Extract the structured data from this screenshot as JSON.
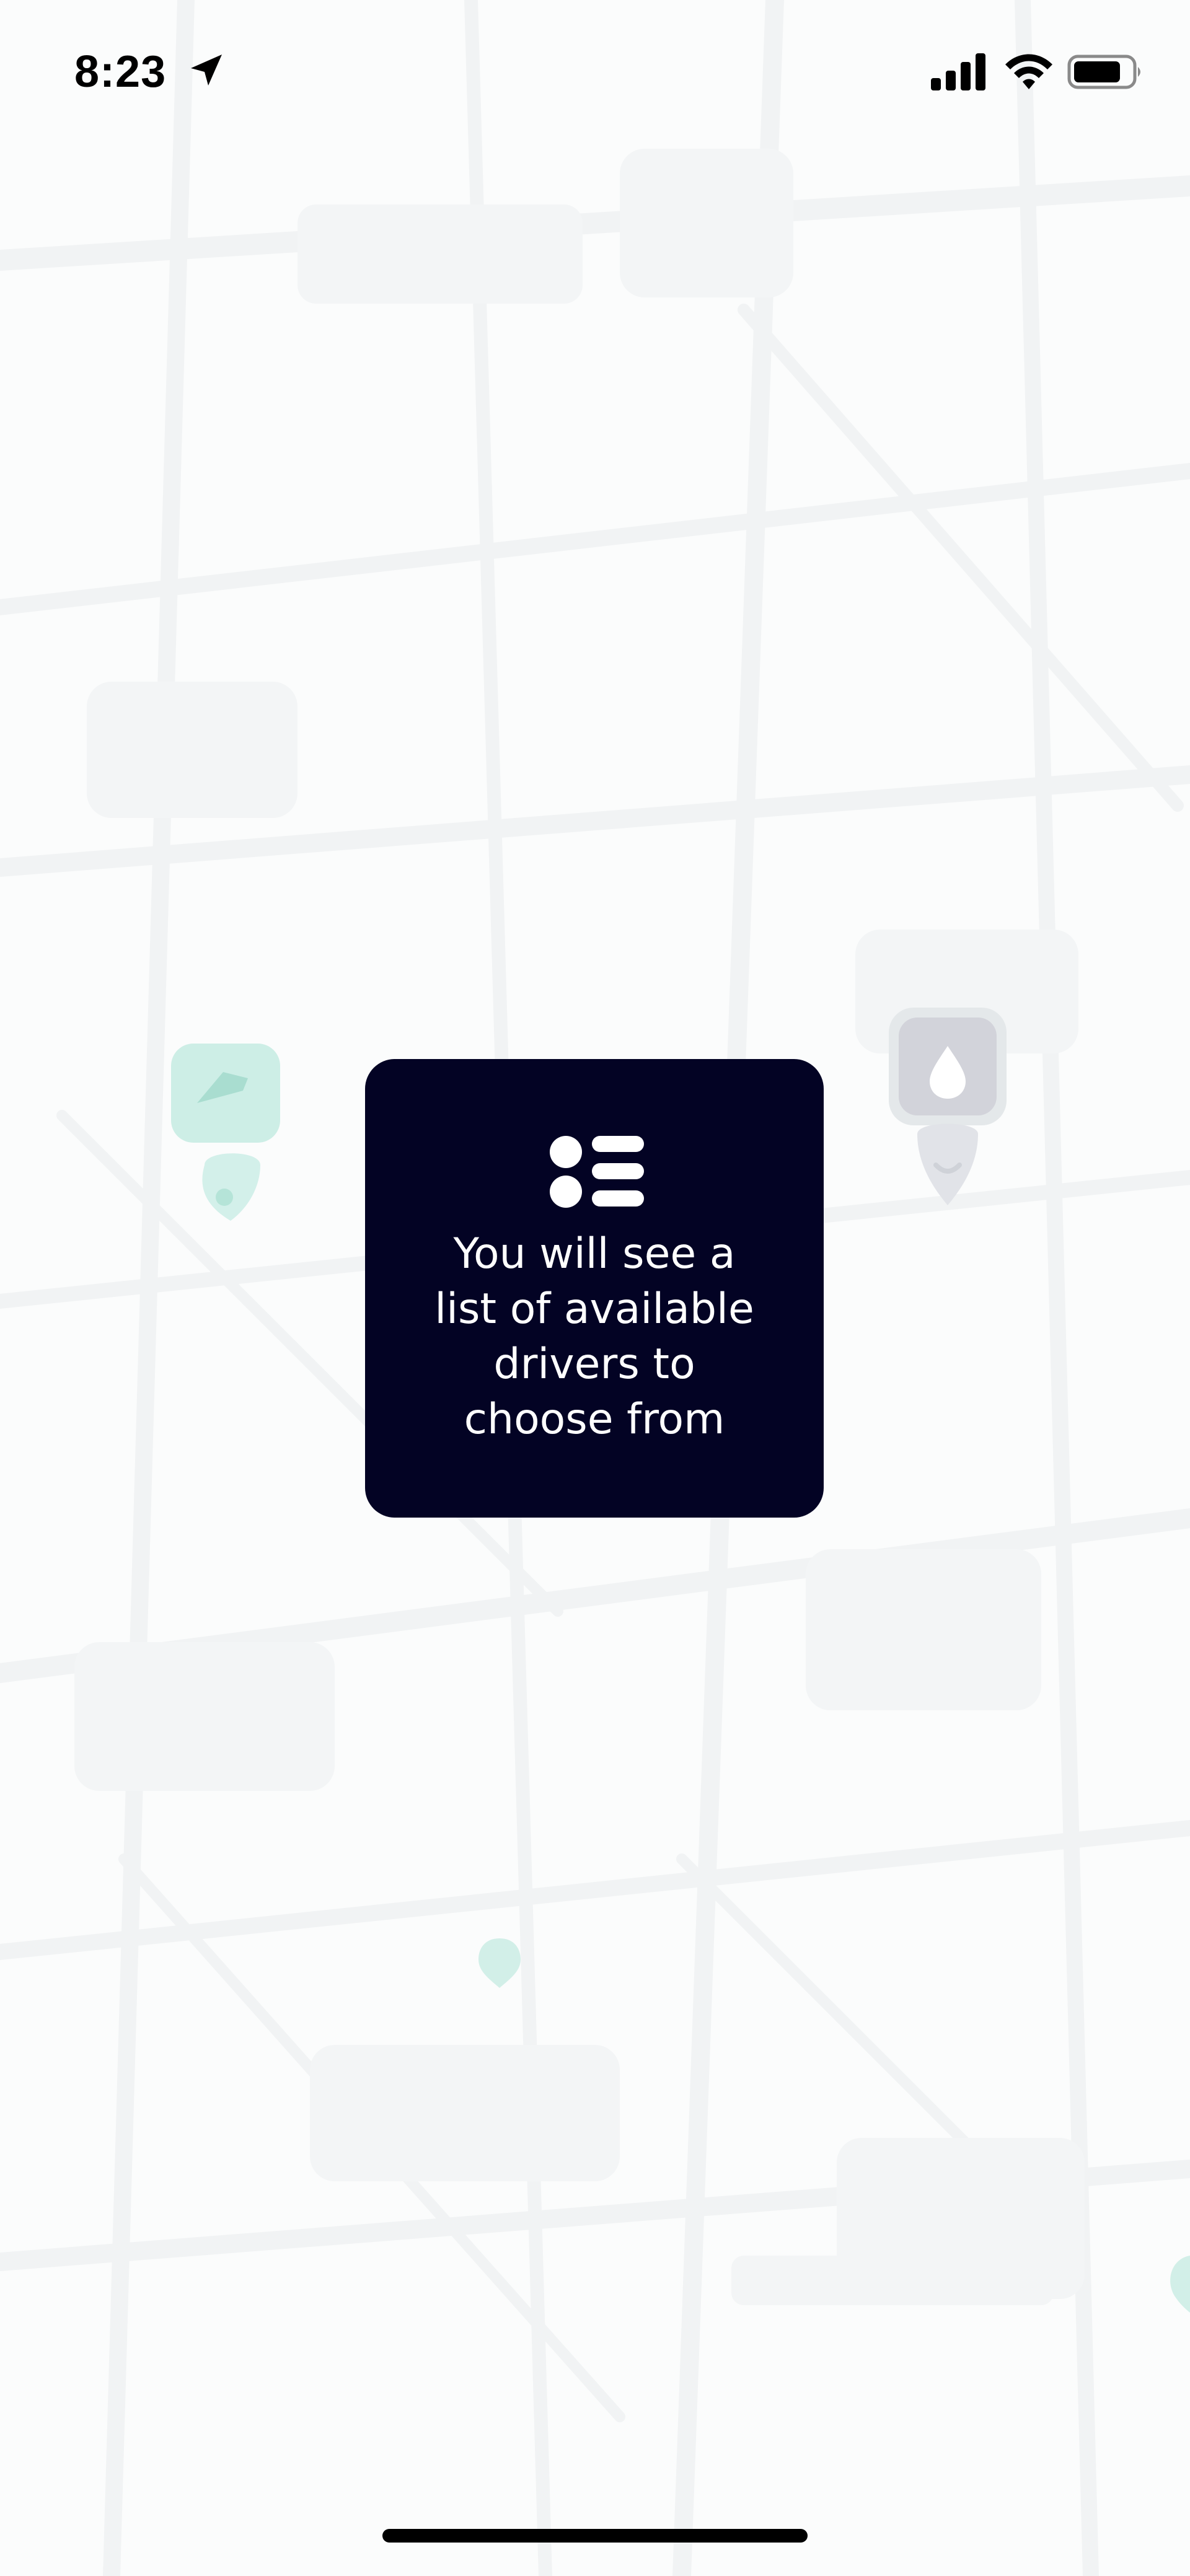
{
  "status_bar": {
    "time": "8:23",
    "icons": [
      "location-arrow-icon",
      "cellular-signal-icon",
      "wifi-icon",
      "battery-icon"
    ]
  },
  "map": {
    "markers": [
      "driver-marker-icon",
      "pickup-pin-icon",
      "location-dot-icon"
    ],
    "accent_color": "#cdeee6",
    "marker_gray": "#d2d3da"
  },
  "info_card": {
    "icon": "list-icon",
    "message": "You will see a\nlist of available\ndrivers to\nchoose from",
    "background_color": "#030324",
    "text_color": "#ffffff"
  }
}
